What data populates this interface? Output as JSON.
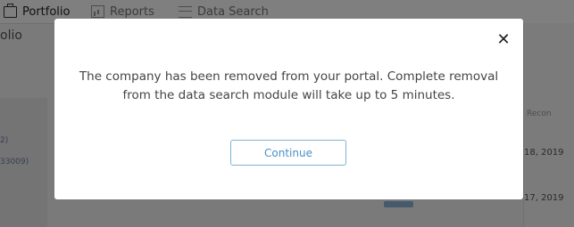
{
  "nav": {
    "items": [
      {
        "label": "Portfolio",
        "icon": "portfolio-icon"
      },
      {
        "label": "Reports",
        "icon": "reports-icon"
      },
      {
        "label": "Data Search",
        "icon": "data-search-icon"
      }
    ]
  },
  "background": {
    "page_title_fragment": "olio",
    "table": {
      "column_header_fragment": "Recon",
      "rows": [
        {
          "id_fragment": "2)",
          "date_fragment": "18, 2019"
        },
        {
          "id_fragment": "33009)",
          "date_fragment": "17, 2019"
        }
      ]
    }
  },
  "modal": {
    "message": "The company has been removed from your portal. Complete removal from the data search module will take up to 5 minutes.",
    "continue_label": "Continue",
    "close_icon": "close-icon"
  },
  "colors": {
    "overlay": "rgba(0,0,0,0.5)",
    "button_border": "#7fb2d3",
    "button_text": "#4a90c6"
  }
}
